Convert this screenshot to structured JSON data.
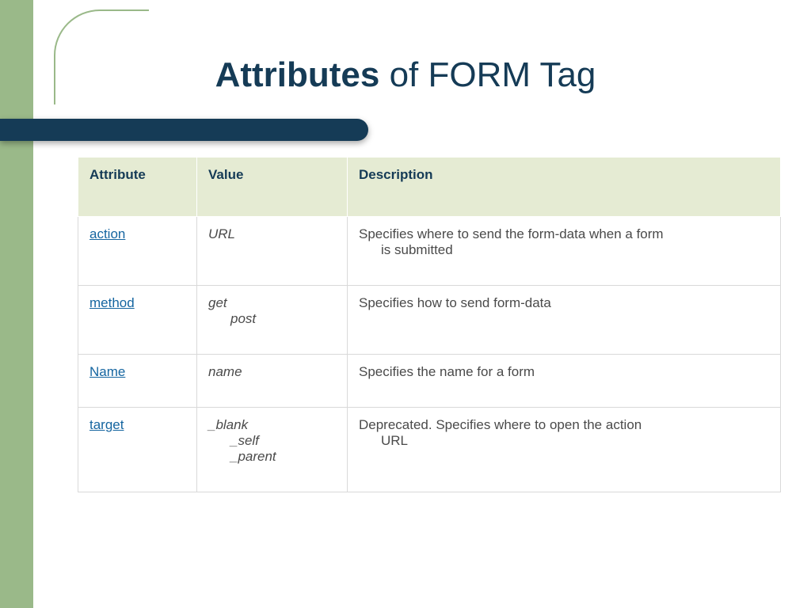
{
  "title": {
    "bold": "Attributes",
    "rest": " of FORM Tag"
  },
  "table": {
    "headers": {
      "attribute": "Attribute",
      "value": "Value",
      "description": "Description"
    },
    "rows": [
      {
        "attribute": "action",
        "values": [
          "URL"
        ],
        "descLines": [
          "Specifies where to send the form-data when a form",
          "is submitted"
        ]
      },
      {
        "attribute": "method",
        "values": [
          "get",
          "post"
        ],
        "descLines": [
          "Specifies how to send form-data"
        ]
      },
      {
        "attribute": "Name",
        "values": [
          "name"
        ],
        "descLines": [
          "Specifies the name for a form"
        ]
      },
      {
        "attribute": "target",
        "values": [
          "_blank",
          "_self",
          "_parent"
        ],
        "descLines": [
          "Deprecated. Specifies where to open the action",
          "URL"
        ]
      }
    ]
  }
}
